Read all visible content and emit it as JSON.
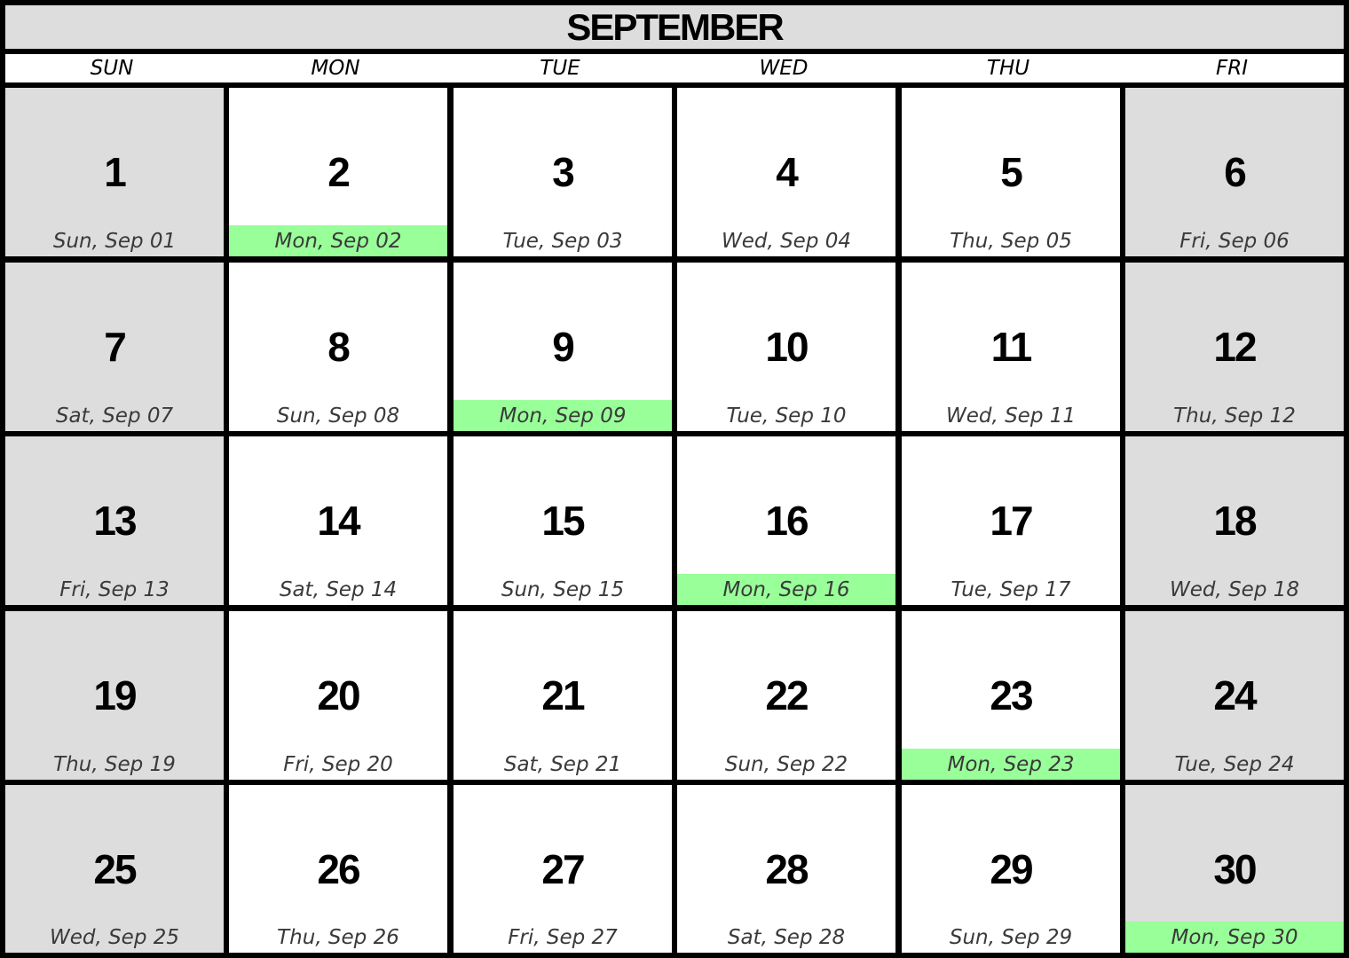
{
  "title": "SEPTEMBER",
  "weekdays": [
    "SUN",
    "MON",
    "TUE",
    "WED",
    "THU",
    "FRI"
  ],
  "colors": {
    "weekend_bg": "#dddddd",
    "highlight": "#99ff99",
    "grid_line": "#000000"
  },
  "weeks": [
    [
      {
        "day": "1",
        "label": "Sun, Sep 01",
        "weekend": true,
        "highlight": false
      },
      {
        "day": "2",
        "label": "Mon, Sep 02",
        "weekend": false,
        "highlight": true
      },
      {
        "day": "3",
        "label": "Tue, Sep 03",
        "weekend": false,
        "highlight": false
      },
      {
        "day": "4",
        "label": "Wed, Sep 04",
        "weekend": false,
        "highlight": false
      },
      {
        "day": "5",
        "label": "Thu, Sep 05",
        "weekend": false,
        "highlight": false
      },
      {
        "day": "6",
        "label": "Fri, Sep 06",
        "weekend": true,
        "highlight": false
      }
    ],
    [
      {
        "day": "7",
        "label": "Sat, Sep 07",
        "weekend": true,
        "highlight": false
      },
      {
        "day": "8",
        "label": "Sun, Sep 08",
        "weekend": false,
        "highlight": false
      },
      {
        "day": "9",
        "label": "Mon, Sep 09",
        "weekend": false,
        "highlight": true
      },
      {
        "day": "10",
        "label": "Tue, Sep 10",
        "weekend": false,
        "highlight": false
      },
      {
        "day": "11",
        "label": "Wed, Sep 11",
        "weekend": false,
        "highlight": false
      },
      {
        "day": "12",
        "label": "Thu, Sep 12",
        "weekend": true,
        "highlight": false
      }
    ],
    [
      {
        "day": "13",
        "label": "Fri, Sep 13",
        "weekend": true,
        "highlight": false
      },
      {
        "day": "14",
        "label": "Sat, Sep 14",
        "weekend": false,
        "highlight": false
      },
      {
        "day": "15",
        "label": "Sun, Sep 15",
        "weekend": false,
        "highlight": false
      },
      {
        "day": "16",
        "label": "Mon, Sep 16",
        "weekend": false,
        "highlight": true
      },
      {
        "day": "17",
        "label": "Tue, Sep 17",
        "weekend": false,
        "highlight": false
      },
      {
        "day": "18",
        "label": "Wed, Sep 18",
        "weekend": true,
        "highlight": false
      }
    ],
    [
      {
        "day": "19",
        "label": "Thu, Sep 19",
        "weekend": true,
        "highlight": false
      },
      {
        "day": "20",
        "label": "Fri, Sep 20",
        "weekend": false,
        "highlight": false
      },
      {
        "day": "21",
        "label": "Sat, Sep 21",
        "weekend": false,
        "highlight": false
      },
      {
        "day": "22",
        "label": "Sun, Sep 22",
        "weekend": false,
        "highlight": false
      },
      {
        "day": "23",
        "label": "Mon, Sep 23",
        "weekend": false,
        "highlight": true
      },
      {
        "day": "24",
        "label": "Tue, Sep 24",
        "weekend": true,
        "highlight": false
      }
    ],
    [
      {
        "day": "25",
        "label": "Wed, Sep 25",
        "weekend": true,
        "highlight": false
      },
      {
        "day": "26",
        "label": "Thu, Sep 26",
        "weekend": false,
        "highlight": false
      },
      {
        "day": "27",
        "label": "Fri, Sep 27",
        "weekend": false,
        "highlight": false
      },
      {
        "day": "28",
        "label": "Sat, Sep 28",
        "weekend": false,
        "highlight": false
      },
      {
        "day": "29",
        "label": "Sun, Sep 29",
        "weekend": false,
        "highlight": false
      },
      {
        "day": "30",
        "label": "Mon, Sep 30",
        "weekend": true,
        "highlight": true
      }
    ]
  ]
}
